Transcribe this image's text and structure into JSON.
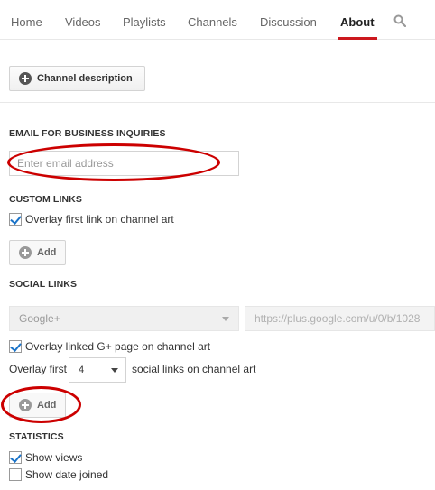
{
  "nav": {
    "tabs": [
      {
        "label": "Home",
        "active": false
      },
      {
        "label": "Videos",
        "active": false
      },
      {
        "label": "Playlists",
        "active": false
      },
      {
        "label": "Channels",
        "active": false
      },
      {
        "label": "Discussion",
        "active": false
      },
      {
        "label": "About",
        "active": true
      }
    ],
    "search_icon": "search-icon",
    "active_color": "#cc181e"
  },
  "description_button": {
    "label": "Channel description",
    "icon": "plus-circle-icon"
  },
  "email_section": {
    "title": "EMAIL FOR BUSINESS INQUIRIES",
    "placeholder": "Enter email address",
    "value": ""
  },
  "custom_links": {
    "title": "CUSTOM LINKS",
    "overlay_checkbox": {
      "label": "Overlay first link on channel art",
      "checked": true
    },
    "add_label": "Add"
  },
  "social_links": {
    "title": "SOCIAL LINKS",
    "network_select": {
      "value": "Google+"
    },
    "url_value": "https://plus.google.com/u/0/b/1028",
    "overlay_checkbox": {
      "label": "Overlay linked G+ page on channel art",
      "checked": true
    },
    "overlay_count_prefix": "Overlay first",
    "overlay_count_value": "4",
    "overlay_count_suffix": "social links on channel art",
    "add_label": "Add"
  },
  "statistics": {
    "title": "STATISTICS",
    "show_views": {
      "label": "Show views",
      "checked": true
    },
    "show_date_joined": {
      "label": "Show date joined",
      "checked": false
    }
  },
  "annotation_color": "#cc0000"
}
